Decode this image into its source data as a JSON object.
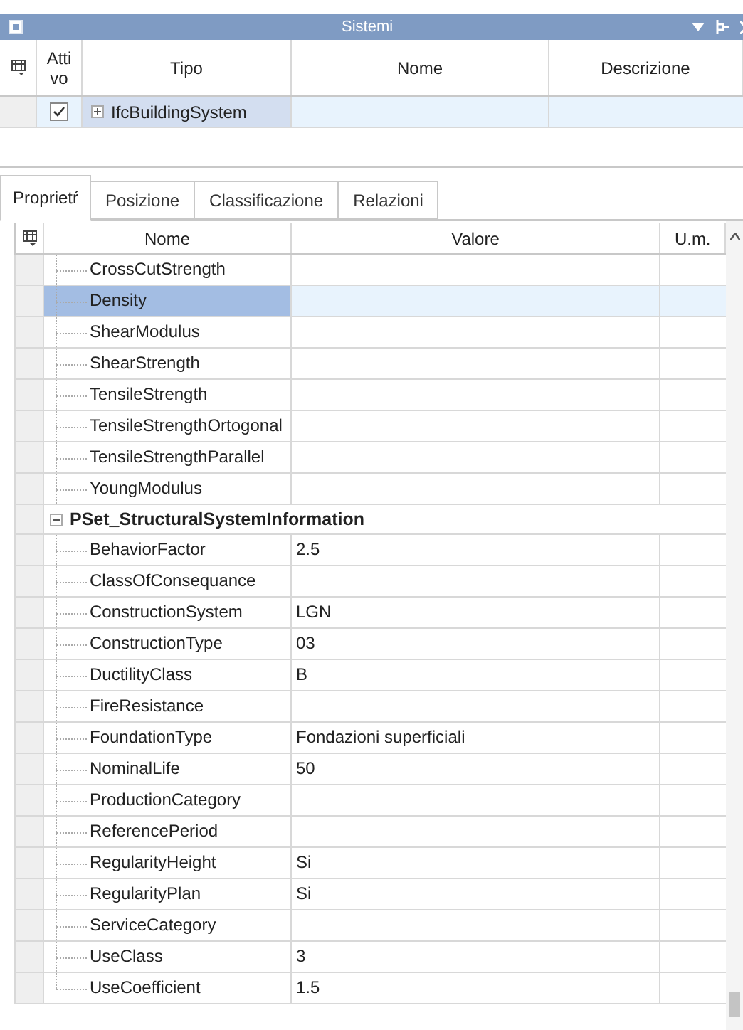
{
  "window": {
    "title": "Sistemi"
  },
  "systems": {
    "columns": [
      "Atti vo",
      "Tipo",
      "Nome",
      "Descrizione"
    ],
    "rows": [
      {
        "active": true,
        "expanded": false,
        "type": "IfcBuildingSystem"
      }
    ]
  },
  "tabs": [
    {
      "label": "Proprietŕ",
      "selected": true
    },
    {
      "label": "Posizione",
      "selected": false
    },
    {
      "label": "Classificazione",
      "selected": false
    },
    {
      "label": "Relazioni",
      "selected": false
    }
  ],
  "properties": {
    "columns": [
      "Nome",
      "Valore",
      "U.m."
    ],
    "rows": [
      {
        "kind": "property",
        "name": "CrossCutStrength",
        "selected": false
      },
      {
        "kind": "property",
        "name": "Density",
        "selected": true
      },
      {
        "kind": "property",
        "name": "ShearModulus",
        "selected": false
      },
      {
        "kind": "property",
        "name": "ShearStrength",
        "selected": false
      },
      {
        "kind": "property",
        "name": "TensileStrength",
        "selected": false
      },
      {
        "kind": "property",
        "name": "TensileStrengthOrtogonal",
        "selected": false
      },
      {
        "kind": "property",
        "name": "TensileStrengthParallel",
        "selected": false
      },
      {
        "kind": "property",
        "name": "YoungModulus",
        "selected": false
      },
      {
        "kind": "group",
        "name": "PSet_StructuralSystemInformation",
        "expanded": true,
        "children": [
          {
            "kind": "property",
            "name": "BehaviorFactor",
            "value": "2.5",
            "selected": false
          },
          {
            "kind": "property",
            "name": "ClassOfConsequance",
            "selected": false
          },
          {
            "kind": "property",
            "name": "ConstructionSystem",
            "value": "LGN",
            "selected": false
          },
          {
            "kind": "property",
            "name": "ConstructionType",
            "value": "03",
            "selected": false
          },
          {
            "kind": "property",
            "name": "DuctilityClass",
            "value": "B",
            "selected": false
          },
          {
            "kind": "property",
            "name": "FireResistance",
            "selected": false
          },
          {
            "kind": "property",
            "name": "FoundationType",
            "value": "Fondazioni superficiali",
            "selected": false
          },
          {
            "kind": "property",
            "name": "NominalLife",
            "value": "50",
            "selected": false
          },
          {
            "kind": "property",
            "name": "ProductionCategory",
            "selected": false
          },
          {
            "kind": "property",
            "name": "ReferencePeriod",
            "selected": false
          },
          {
            "kind": "property",
            "name": "RegularityHeight",
            "value": "Si",
            "selected": false
          },
          {
            "kind": "property",
            "name": "RegularityPlan",
            "value": "Si",
            "selected": false
          },
          {
            "kind": "property",
            "name": "ServiceCategory",
            "selected": false
          },
          {
            "kind": "property",
            "name": "UseClass",
            "value": "3",
            "selected": false
          },
          {
            "kind": "property",
            "name": "UseCoefficient",
            "value": "1.5",
            "selected": false
          }
        ]
      }
    ]
  }
}
